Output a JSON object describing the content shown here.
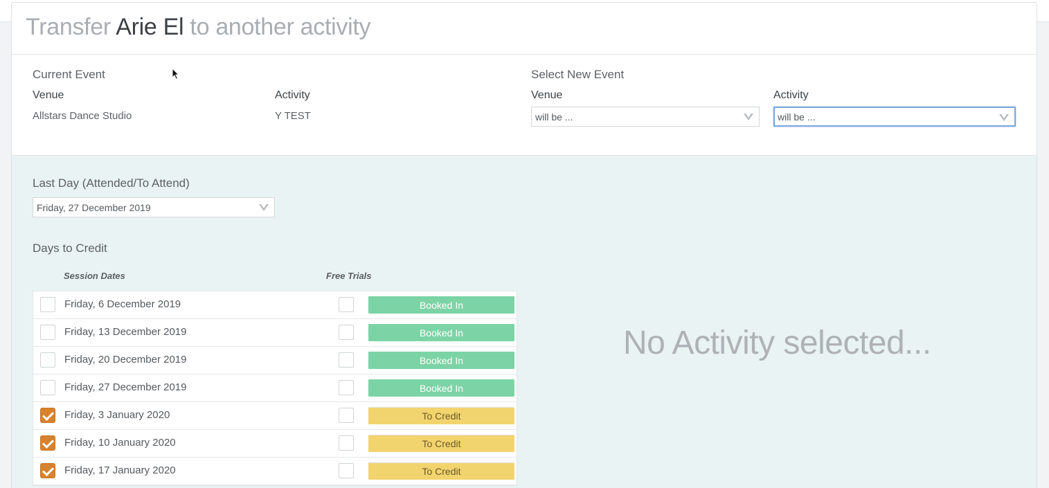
{
  "dialog": {
    "title_prefix": "Transfer",
    "participant_name": "Arie El",
    "title_suffix": "to another activity"
  },
  "current_event": {
    "heading": "Current Event",
    "venue_label": "Venue",
    "venue_value": "Allstars Dance Studio",
    "activity_label": "Activity",
    "activity_value": "Y TEST"
  },
  "new_event": {
    "heading": "Select New Event",
    "venue_label": "Venue",
    "venue_select_value": "will be ...",
    "activity_label": "Activity",
    "activity_select_value": "will be ..."
  },
  "last_day": {
    "label": "Last Day (Attended/To Attend)",
    "selected": "Friday, 27 December 2019"
  },
  "days_to_credit": {
    "heading": "Days to Credit",
    "col_session_dates": "Session Dates",
    "col_free_trials": "Free Trials",
    "rows": [
      {
        "date": "Friday, 6 December 2019",
        "checked": false,
        "free_trial": false,
        "status": "Booked In",
        "status_type": "booked"
      },
      {
        "date": "Friday, 13 December 2019",
        "checked": false,
        "free_trial": false,
        "status": "Booked In",
        "status_type": "booked"
      },
      {
        "date": "Friday, 20 December 2019",
        "checked": false,
        "free_trial": false,
        "status": "Booked In",
        "status_type": "booked"
      },
      {
        "date": "Friday, 27 December 2019",
        "checked": false,
        "free_trial": false,
        "status": "Booked In",
        "status_type": "booked"
      },
      {
        "date": "Friday, 3 January 2020",
        "checked": true,
        "free_trial": false,
        "status": "To Credit",
        "status_type": "credit"
      },
      {
        "date": "Friday, 10 January 2020",
        "checked": true,
        "free_trial": false,
        "status": "To Credit",
        "status_type": "credit"
      },
      {
        "date": "Friday, 17 January 2020",
        "checked": true,
        "free_trial": false,
        "status": "To Credit",
        "status_type": "credit"
      }
    ]
  },
  "no_activity_message": "No Activity selected...",
  "colors": {
    "booked": "#7cd4a6",
    "to_credit": "#f2d46e",
    "checked": "#d7822e",
    "credit_bg": "#e9f3f4"
  }
}
